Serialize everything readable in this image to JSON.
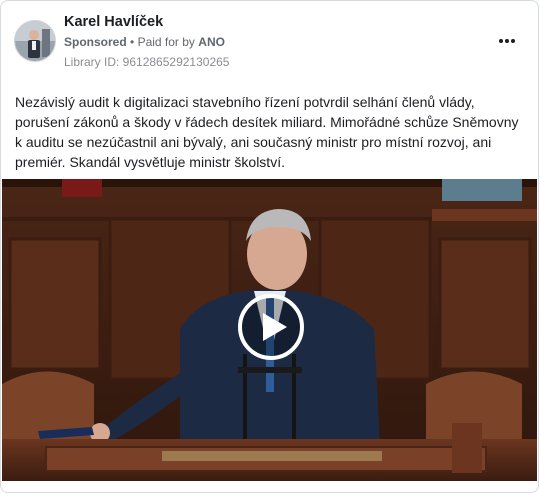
{
  "post": {
    "author_name": "Karel Havlíček",
    "sponsored_label": "Sponsored",
    "separator": "•",
    "paid_for_prefix": "Paid for by",
    "paid_for_by": "ANO",
    "library_id": "Library ID: 9612865292130265",
    "text": "Nezávislý audit k digitalizaci stavebního řízení potvrdil selhání členů vlády, porušení zákonů a škody v řádech desítek miliard. Mimořádné schůze Sněmovny k auditu se nezúčastnil ani bývalý, ani současný ministr pro místní rozvoj, ani premiér. Skandál vysvětluje ministr školství.",
    "more_icon": "more-horizontal-icon",
    "video": {
      "play_icon": "play-icon",
      "scene": "parliament-speaker-at-podium"
    }
  },
  "colors": {
    "author": "#1c1e21",
    "meta": "#65676b",
    "library": "#8a8d91",
    "wood": "#5a2c1a"
  }
}
